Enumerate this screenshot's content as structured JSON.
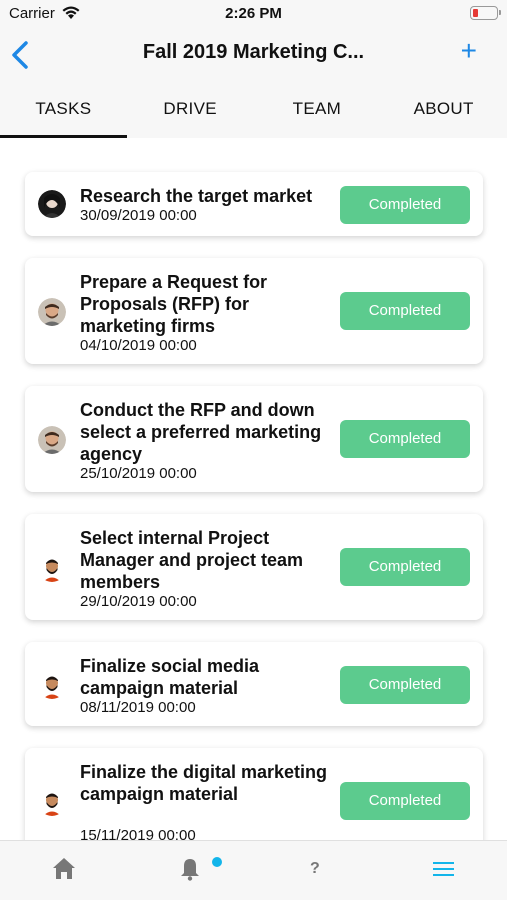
{
  "status_bar": {
    "carrier": "Carrier",
    "time": "2:26 PM"
  },
  "header": {
    "title": "Fall 2019 Marketing C...",
    "back_icon": "chevron-left-icon",
    "add_label": "+"
  },
  "tabs": [
    {
      "label": "TASKS",
      "active": true
    },
    {
      "label": "DRIVE",
      "active": false
    },
    {
      "label": "TEAM",
      "active": false
    },
    {
      "label": "ABOUT",
      "active": false
    }
  ],
  "tasks": [
    {
      "title": "Research the target market",
      "date": "30/09/2019 00:00",
      "status": "Completed"
    },
    {
      "title": "Prepare a Request for Proposals (RFP) for marketing firms",
      "date": "04/10/2019 00:00",
      "status": "Completed"
    },
    {
      "title": "Conduct the RFP and down select a preferred marketing agency",
      "date": "25/10/2019 00:00",
      "status": "Completed"
    },
    {
      "title": "Select internal Project Manager and project team members",
      "date": "29/10/2019 00:00",
      "status": "Completed"
    },
    {
      "title": "Finalize social media campaign material",
      "date": "08/11/2019 00:00",
      "status": "Completed"
    },
    {
      "title": "Finalize the digital marketing campaign material",
      "date": "15/11/2019 00:00",
      "status": "Completed"
    }
  ],
  "bottom_nav": [
    {
      "icon": "home-icon"
    },
    {
      "icon": "bell-icon"
    },
    {
      "icon": "help-icon",
      "label": "?"
    },
    {
      "icon": "menu-icon"
    }
  ],
  "colors": {
    "accent": "#1e88e5",
    "completed": "#5ccb8e",
    "notification_dot": "#13b5ea",
    "battery_low": "#e53935"
  }
}
